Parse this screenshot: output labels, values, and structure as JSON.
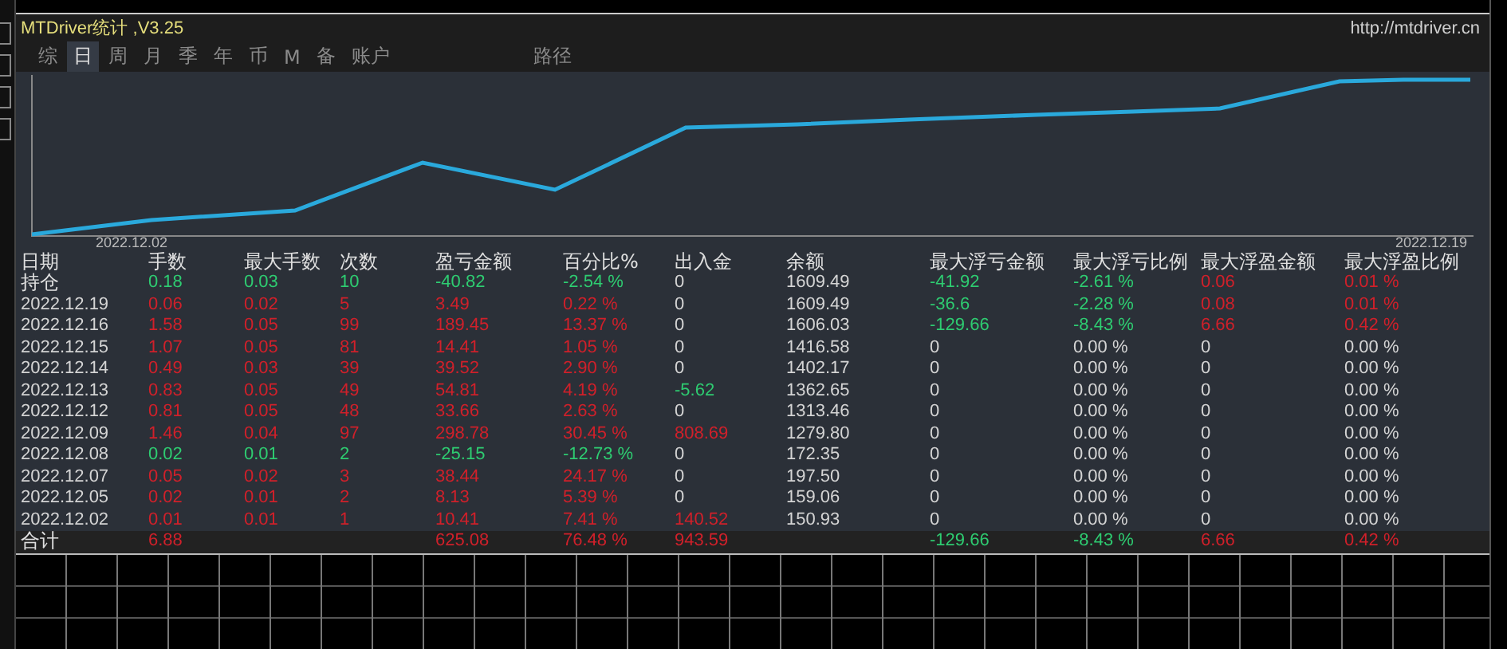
{
  "window": {
    "title": "MTDriver统计 ,V3.25",
    "url": "http://mtdriver.cn"
  },
  "tabs": [
    {
      "label": "综",
      "selected": false
    },
    {
      "label": "日",
      "selected": true
    },
    {
      "label": "周",
      "selected": false
    },
    {
      "label": "月",
      "selected": false
    },
    {
      "label": "季",
      "selected": false
    },
    {
      "label": "年",
      "selected": false
    },
    {
      "label": "币",
      "selected": false
    },
    {
      "label": "M",
      "selected": false
    },
    {
      "label": "备",
      "selected": false
    },
    {
      "label": "账户",
      "selected": false
    }
  ],
  "path_button": "路径",
  "equity_chart": {
    "start_label": "2022.12.02",
    "end_label": "2022.12.19"
  },
  "table": {
    "columns": [
      "日期",
      "手数",
      "最大手数",
      "次数",
      "盈亏金额",
      "百分比%",
      "出入金",
      "余额",
      "最大浮亏金额",
      "最大浮亏比例",
      "最大浮盈金额",
      "最大浮盈比例"
    ],
    "rows": [
      {
        "kind": "position",
        "cells": [
          "持仓",
          {
            "text": "0.18",
            "color": "#2ecc71"
          },
          {
            "text": "0.03",
            "color": "#2ecc71"
          },
          {
            "text": "10",
            "color": "#2ecc71"
          },
          {
            "text": "-40.82",
            "color": "#2ecc71"
          },
          {
            "text": "-2.54 %",
            "color": "#2ecc71"
          },
          "0",
          "1609.49",
          {
            "text": "-41.92",
            "color": "#2ecc71"
          },
          {
            "text": "-2.61 %",
            "color": "#2ecc71"
          },
          {
            "text": "0.06",
            "color": "#d0202a"
          },
          {
            "text": "0.01 %",
            "color": "#d0202a"
          }
        ]
      },
      {
        "kind": "day",
        "cells": [
          "2022.12.19",
          {
            "text": "0.06",
            "color": "#d0202a"
          },
          {
            "text": "0.02",
            "color": "#d0202a"
          },
          {
            "text": "5",
            "color": "#d0202a"
          },
          {
            "text": "3.49",
            "color": "#d0202a"
          },
          {
            "text": "0.22 %",
            "color": "#d0202a"
          },
          "0",
          "1609.49",
          {
            "text": "-36.6",
            "color": "#2ecc71"
          },
          {
            "text": "-2.28 %",
            "color": "#2ecc71"
          },
          {
            "text": "0.08",
            "color": "#d0202a"
          },
          {
            "text": "0.01 %",
            "color": "#d0202a"
          }
        ]
      },
      {
        "kind": "day",
        "cells": [
          "2022.12.16",
          {
            "text": "1.58",
            "color": "#d0202a"
          },
          {
            "text": "0.05",
            "color": "#d0202a"
          },
          {
            "text": "99",
            "color": "#d0202a"
          },
          {
            "text": "189.45",
            "color": "#d0202a"
          },
          {
            "text": "13.37 %",
            "color": "#d0202a"
          },
          "0",
          "1606.03",
          {
            "text": "-129.66",
            "color": "#2ecc71"
          },
          {
            "text": "-8.43 %",
            "color": "#2ecc71"
          },
          {
            "text": "6.66",
            "color": "#d0202a"
          },
          {
            "text": "0.42 %",
            "color": "#d0202a"
          }
        ]
      },
      {
        "kind": "day",
        "cells": [
          "2022.12.15",
          {
            "text": "1.07",
            "color": "#d0202a"
          },
          {
            "text": "0.05",
            "color": "#d0202a"
          },
          {
            "text": "81",
            "color": "#d0202a"
          },
          {
            "text": "14.41",
            "color": "#d0202a"
          },
          {
            "text": "1.05 %",
            "color": "#d0202a"
          },
          "0",
          "1416.58",
          "0",
          "0.00 %",
          "0",
          "0.00 %"
        ]
      },
      {
        "kind": "day",
        "cells": [
          "2022.12.14",
          {
            "text": "0.49",
            "color": "#d0202a"
          },
          {
            "text": "0.03",
            "color": "#d0202a"
          },
          {
            "text": "39",
            "color": "#d0202a"
          },
          {
            "text": "39.52",
            "color": "#d0202a"
          },
          {
            "text": "2.90 %",
            "color": "#d0202a"
          },
          "0",
          "1402.17",
          "0",
          "0.00 %",
          "0",
          "0.00 %"
        ]
      },
      {
        "kind": "day",
        "cells": [
          "2022.12.13",
          {
            "text": "0.83",
            "color": "#d0202a"
          },
          {
            "text": "0.05",
            "color": "#d0202a"
          },
          {
            "text": "49",
            "color": "#d0202a"
          },
          {
            "text": "54.81",
            "color": "#d0202a"
          },
          {
            "text": "4.19 %",
            "color": "#d0202a"
          },
          {
            "text": "-5.62",
            "color": "#2ecc71"
          },
          "1362.65",
          "0",
          "0.00 %",
          "0",
          "0.00 %"
        ]
      },
      {
        "kind": "day",
        "cells": [
          "2022.12.12",
          {
            "text": "0.81",
            "color": "#d0202a"
          },
          {
            "text": "0.05",
            "color": "#d0202a"
          },
          {
            "text": "48",
            "color": "#d0202a"
          },
          {
            "text": "33.66",
            "color": "#d0202a"
          },
          {
            "text": "2.63 %",
            "color": "#d0202a"
          },
          "0",
          "1313.46",
          "0",
          "0.00 %",
          "0",
          "0.00 %"
        ]
      },
      {
        "kind": "day",
        "cells": [
          "2022.12.09",
          {
            "text": "1.46",
            "color": "#d0202a"
          },
          {
            "text": "0.04",
            "color": "#d0202a"
          },
          {
            "text": "97",
            "color": "#d0202a"
          },
          {
            "text": "298.78",
            "color": "#d0202a"
          },
          {
            "text": "30.45 %",
            "color": "#d0202a"
          },
          {
            "text": "808.69",
            "color": "#d0202a"
          },
          "1279.80",
          "0",
          "0.00 %",
          "0",
          "0.00 %"
        ]
      },
      {
        "kind": "day",
        "cells": [
          "2022.12.08",
          {
            "text": "0.02",
            "color": "#2ecc71"
          },
          {
            "text": "0.01",
            "color": "#2ecc71"
          },
          {
            "text": "2",
            "color": "#2ecc71"
          },
          {
            "text": "-25.15",
            "color": "#2ecc71"
          },
          {
            "text": "-12.73 %",
            "color": "#2ecc71"
          },
          "0",
          "172.35",
          "0",
          "0.00 %",
          "0",
          "0.00 %"
        ]
      },
      {
        "kind": "day",
        "cells": [
          "2022.12.07",
          {
            "text": "0.05",
            "color": "#d0202a"
          },
          {
            "text": "0.02",
            "color": "#d0202a"
          },
          {
            "text": "3",
            "color": "#d0202a"
          },
          {
            "text": "38.44",
            "color": "#d0202a"
          },
          {
            "text": "24.17 %",
            "color": "#d0202a"
          },
          "0",
          "197.50",
          "0",
          "0.00 %",
          "0",
          "0.00 %"
        ]
      },
      {
        "kind": "day",
        "cells": [
          "2022.12.05",
          {
            "text": "0.02",
            "color": "#d0202a"
          },
          {
            "text": "0.01",
            "color": "#d0202a"
          },
          {
            "text": "2",
            "color": "#d0202a"
          },
          {
            "text": "8.13",
            "color": "#d0202a"
          },
          {
            "text": "5.39 %",
            "color": "#d0202a"
          },
          "0",
          "159.06",
          "0",
          "0.00 %",
          "0",
          "0.00 %"
        ]
      },
      {
        "kind": "day",
        "cells": [
          "2022.12.02",
          {
            "text": "0.01",
            "color": "#d0202a"
          },
          {
            "text": "0.01",
            "color": "#d0202a"
          },
          {
            "text": "1",
            "color": "#d0202a"
          },
          {
            "text": "10.41",
            "color": "#d0202a"
          },
          {
            "text": "7.41 %",
            "color": "#d0202a"
          },
          {
            "text": "140.52",
            "color": "#d0202a"
          },
          "150.93",
          "0",
          "0.00 %",
          "0",
          "0.00 %"
        ]
      },
      {
        "kind": "total",
        "cells": [
          "合计",
          {
            "text": "6.88",
            "color": "#d0202a"
          },
          null,
          null,
          {
            "text": "625.08",
            "color": "#d0202a"
          },
          {
            "text": "76.48 %",
            "color": "#d0202a"
          },
          {
            "text": "943.59",
            "color": "#d0202a"
          },
          null,
          {
            "text": "-129.66",
            "color": "#2ecc71"
          },
          {
            "text": "-8.43 %",
            "color": "#2ecc71"
          },
          {
            "text": "6.66",
            "color": "#d0202a"
          },
          {
            "text": "0.42 %",
            "color": "#d0202a"
          }
        ]
      }
    ]
  }
}
